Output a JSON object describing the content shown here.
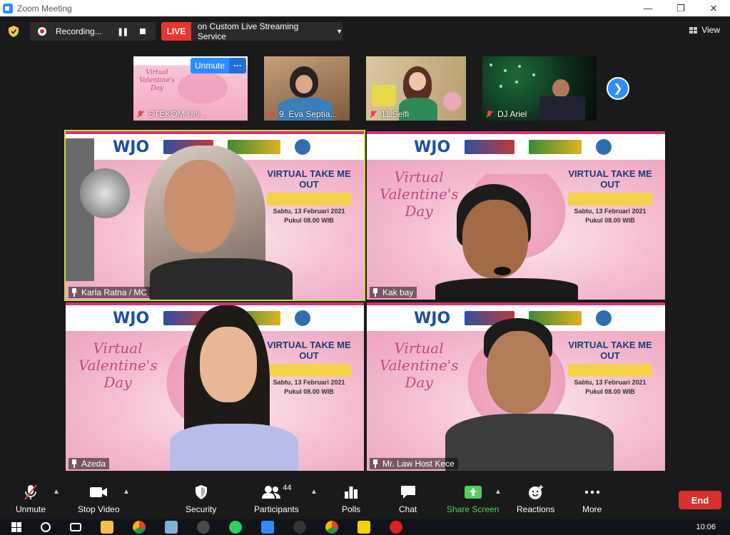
{
  "window": {
    "title": "Zoom Meeting"
  },
  "topbar": {
    "recording_label": "Recording...",
    "live_badge": "LIVE",
    "live_text": "on Custom Live Streaming Service",
    "view_label": "View"
  },
  "thumbnails": [
    {
      "name": "STEKOM Uni...",
      "muted": true
    },
    {
      "name": "9. Eva Septia...",
      "muted": true
    },
    {
      "name": "11.Selfi",
      "muted": true
    },
    {
      "name": "DJ Ariel",
      "muted": true
    }
  ],
  "thumbnail_actions": {
    "unmute_label": "Unmute",
    "more_label": "···"
  },
  "tiles": [
    {
      "name": "Karla Ratna / MC",
      "active": true
    },
    {
      "name": "Kak bay",
      "active": false
    },
    {
      "name": "Azeda",
      "active": false
    },
    {
      "name": "Mr. Law Host Kece",
      "active": false
    }
  ],
  "banner": {
    "brand": "WJO",
    "vday_text": "Virtual Valentine's Day",
    "event_title": "VIRTUAL TAKE ME OUT",
    "event_date": "Sabtu, 13 Februari 2021",
    "event_time": "Pukul 08.00 WIB"
  },
  "toolbar": {
    "unmute": "Unmute",
    "stop_video": "Stop Video",
    "security": "Security",
    "participants": "Participants",
    "participants_count": "44",
    "polls": "Polls",
    "chat": "Chat",
    "share_screen": "Share Screen",
    "reactions": "Reactions",
    "more": "More",
    "end": "End"
  },
  "taskbar": {
    "clock": "10:06"
  },
  "colors": {
    "accent": "#2d8cff",
    "live": "#e8352f",
    "end": "#d8312f",
    "share": "#4fd25a",
    "active_speaker": "#c9dc3a"
  }
}
